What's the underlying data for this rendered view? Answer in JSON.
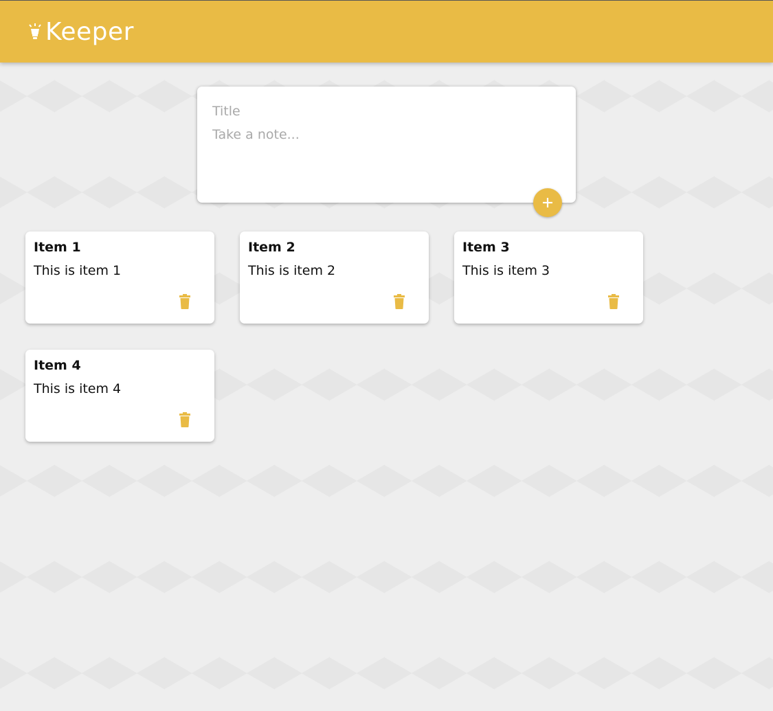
{
  "app": {
    "title": "Keeper",
    "logo_icon": "lightbulb-icon",
    "accent_color": "#e9bb45"
  },
  "composer": {
    "title_placeholder": "Title",
    "content_placeholder": "Take a note...",
    "add_icon": "plus-icon"
  },
  "notes": [
    {
      "title": "Item 1",
      "content": "This is item 1",
      "delete_icon": "trash-icon"
    },
    {
      "title": "Item 2",
      "content": "This is item 2",
      "delete_icon": "trash-icon"
    },
    {
      "title": "Item 3",
      "content": "This is item 3",
      "delete_icon": "trash-icon"
    },
    {
      "title": "Item 4",
      "content": "This is item 4",
      "delete_icon": "trash-icon"
    }
  ]
}
